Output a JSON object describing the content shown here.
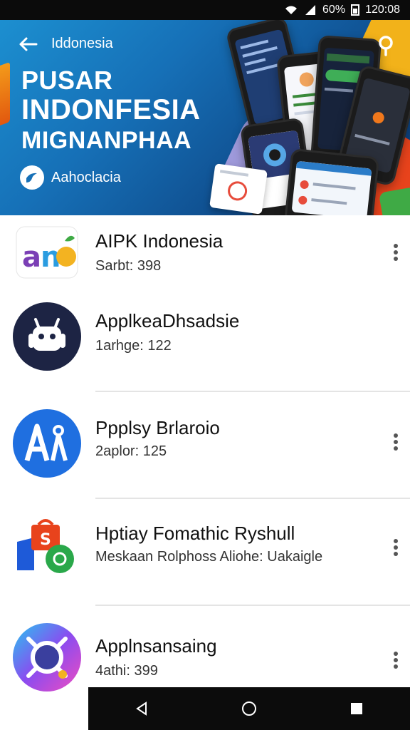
{
  "status_bar": {
    "battery": "60%",
    "time": "120:08"
  },
  "banner": {
    "title": "Iddonesia",
    "headline_1": "PUSAR",
    "headline_2": "INDONFESIA",
    "headline_3": "MIGNANPHAA",
    "badge_label": "Aahoclacia"
  },
  "apps": [
    {
      "name": "AIPK Indonesia",
      "meta": "Sarbt: 398",
      "icon": "aipk-logo-icon"
    },
    {
      "name": "ApplkeaDhsadsie",
      "meta": "1arhge: 122",
      "icon": "android-robot-icon"
    },
    {
      "name": "Ppplsy Brlaroio",
      "meta": "2aplor: 125",
      "icon": "ai-compass-icon"
    },
    {
      "name": "Hptiay Fomathic Ryshull",
      "meta": "Meskaan Rolphoss Aliohe: Uakaigle",
      "icon": "shopping-chat-icon"
    },
    {
      "name": "Applnsansaing",
      "meta": "4athi: 399",
      "icon": "gradient-ring-icon"
    }
  ],
  "colors": {
    "banner_start": "#1c8fd0",
    "banner_end": "#0b3b76",
    "accent_orange": "#f39a1a"
  }
}
